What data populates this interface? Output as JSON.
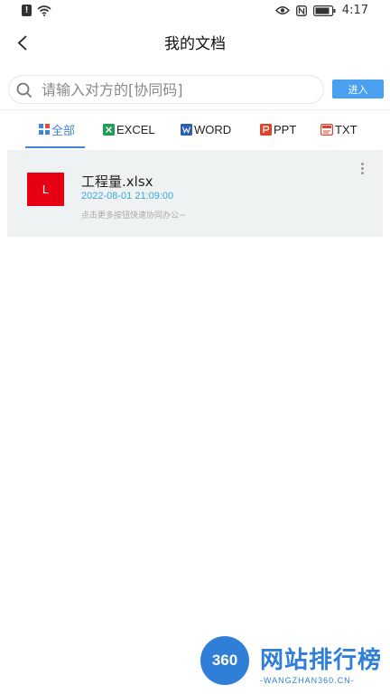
{
  "status_bar": {
    "time": "4:17"
  },
  "header": {
    "title": "我的文档"
  },
  "search": {
    "placeholder": "请输入对方的[协同码]",
    "value": "",
    "enter_label": "进入"
  },
  "tabs": [
    {
      "label": "全部",
      "icon": "all-grid-icon",
      "active": true
    },
    {
      "label": "EXCEL",
      "icon": "excel-icon",
      "active": false
    },
    {
      "label": "WORD",
      "icon": "word-icon",
      "active": false
    },
    {
      "label": "PPT",
      "icon": "ppt-icon",
      "active": false
    },
    {
      "label": "TXT",
      "icon": "txt-icon",
      "active": false
    }
  ],
  "files": [
    {
      "thumb_letter": "L",
      "name": "工程量.xlsx",
      "date": "2022-08-01 21:09:00",
      "hint": "点击更多按钮快速协同办公~"
    }
  ],
  "watermark": {
    "logo_text": "360",
    "name": "网站排行榜",
    "sub": "-WANGZHAN360.CN-"
  },
  "colors": {
    "accent": "#3f86d8",
    "enter_button": "#4aa0f0",
    "thumb_red": "#e60012",
    "date_blue": "#3aa9d8",
    "card_bg": "#eef2f3"
  }
}
